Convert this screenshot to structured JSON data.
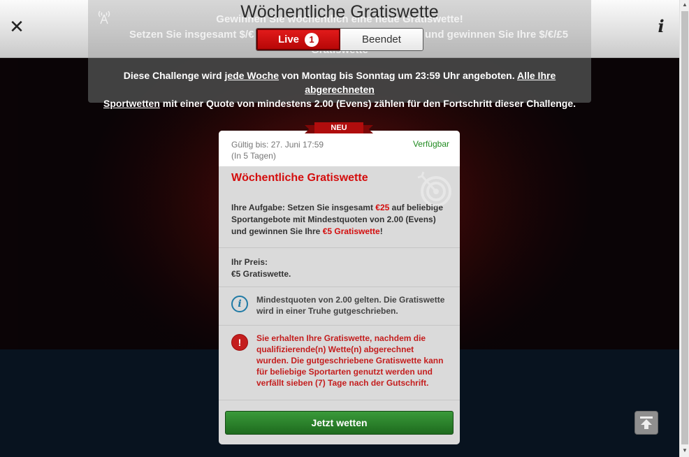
{
  "header": {
    "title": "Wöchentliche Gratiswette",
    "ghost_line1": "Gewinnen Sie wöchentlich eine neue Gratiswette!",
    "ghost_line2_left": "Setzen Sie insgesamt $/€",
    "ghost_line2_right": "und gewinnen Sie Ihre $/€/£5",
    "ghost_line3": "Gratiswette",
    "tabs": {
      "live_label": "Live",
      "live_count": "1",
      "done_label": "Beendet"
    }
  },
  "description": {
    "p1": "Diese Challenge wird ",
    "link1": "jede Woche",
    "p2": " von Montag bis Sonntag um 23:59 Uhr angeboten. ",
    "link2a": "Alle Ihre abgerechneten",
    "link2b": "Sportwetten",
    "p3": " mit einer Quote von mindestens 2.00 (Evens) zählen für den Fortschritt dieser Challenge."
  },
  "card": {
    "ribbon": "NEU",
    "valid_until": "Gültig bis: 27. Juni 17:59",
    "remaining": "(In 5 Tagen)",
    "status": "Verfügbar",
    "title": "Wöchentliche Gratiswette",
    "task_a": "Ihre Aufgabe: Setzen Sie insgesamt ",
    "task_amount": "€25",
    "task_b": " auf beliebige Sportangebote mit Mindestquoten von 2.00 (Evens) und gewinnen Sie Ihre ",
    "task_reward": "€5 Gratiswette",
    "task_c": "!",
    "prize_label": "Ihr Preis:",
    "prize_value": "€5 Gratiswette.",
    "info_note": "Mindestquoten von 2.00 gelten. Die Gratiswette wird in einer Truhe gutgeschrieben.",
    "warning_note": "Sie erhalten Ihre Gratiswette, nachdem die qualifizierende(n) Wette(n) abgerechnet wurden. Die gutgeschriebene Gratiswette kann für beliebige Sportarten genutzt werden und verfällt sieben (7) Tage nach der Gutschrift.",
    "cta_label": "Jetzt wetten"
  },
  "icons": {
    "close": "close-icon",
    "info": "info-icon",
    "target": "target-icon",
    "note_info": "info-circle-icon",
    "note_warning": "exclamation-circle-icon",
    "to_top": "scroll-to-top-icon"
  },
  "colors": {
    "accent_red": "#d40d0d",
    "cta_green": "#2a832a",
    "available_green": "#1f8a1f",
    "info_blue": "#1f7aa5"
  }
}
